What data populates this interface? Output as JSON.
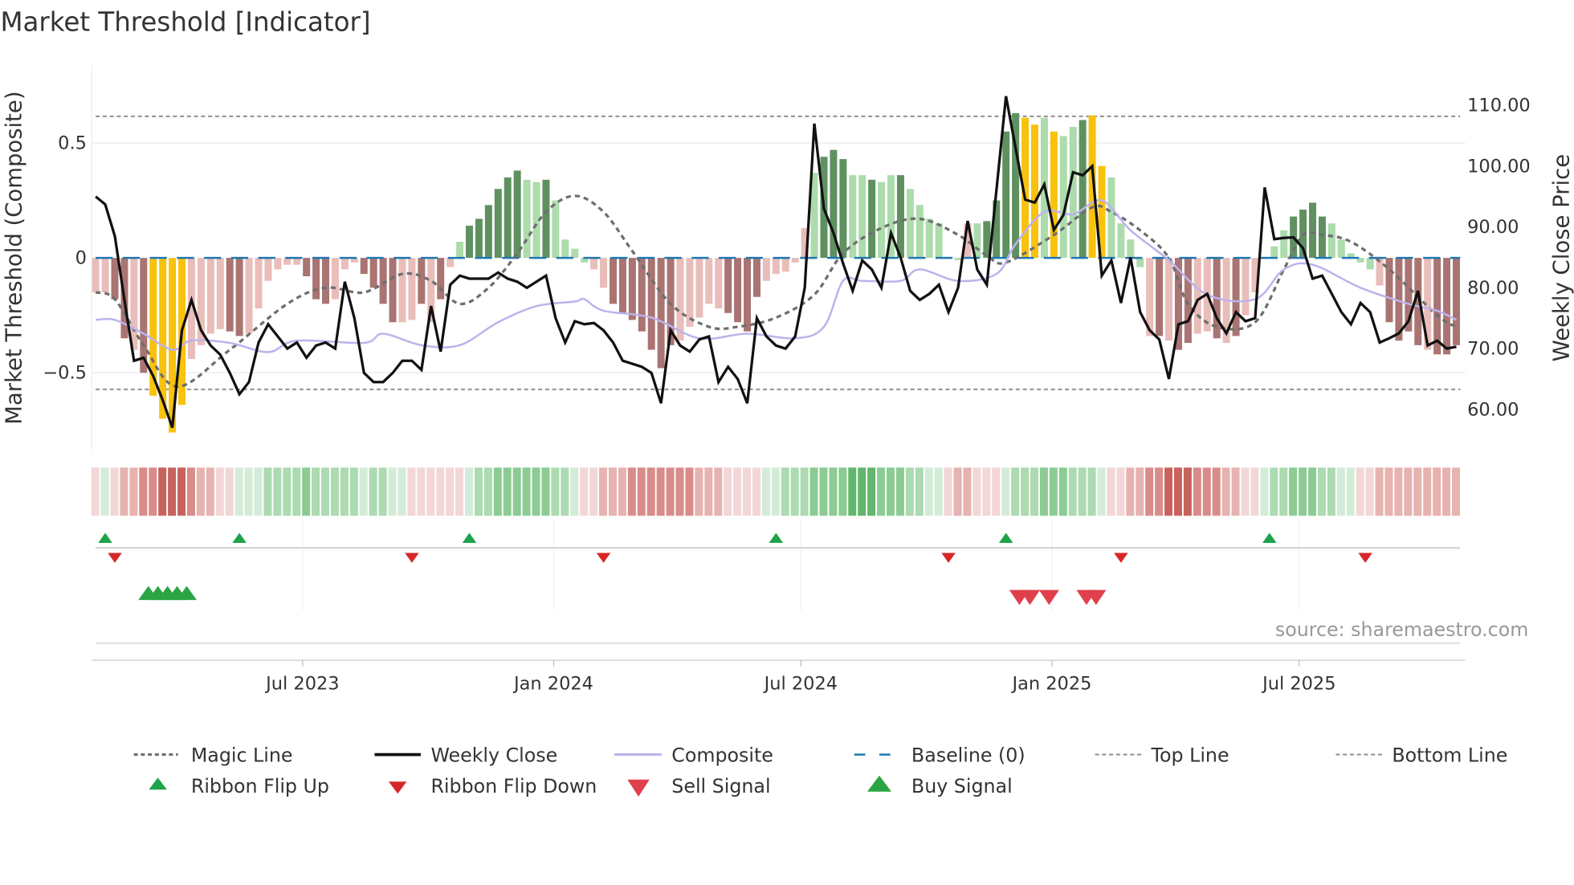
{
  "title": "Market Threshold [Indicator]",
  "source": "source: sharemaestro.com",
  "colors": {
    "bar_dark_red": "#a97472",
    "bar_light_red": "#e9bdb9",
    "bar_dark_green": "#5f9160",
    "bar_light_green": "#acdcab",
    "bar_gold": "#f8c20d",
    "weekly_close": "#111111",
    "composite": "#bcb3ec",
    "magic": "#6e6e6e",
    "baseline": "#1f77b4",
    "threshold": "#888888",
    "flip_up": "#1ea34a",
    "flip_down": "#d62728",
    "buy": "#2ca444",
    "sell": "#e0404c",
    "ribbon_green": [
      "#d3ecd7",
      "#acdab1",
      "#8ccb93",
      "#62b66d"
    ],
    "ribbon_red": [
      "#f3d6d6",
      "#e6b3b0",
      "#d98c89",
      "#c8625d"
    ]
  },
  "chart_data": {
    "type": "bar",
    "title": "Market Threshold [Indicator]",
    "xlabel": "",
    "ylabel": "Market Threshold (Composite)",
    "y2label": "Weekly Close Price",
    "x_unit": "week index",
    "ylim": [
      -0.84,
      0.84
    ],
    "y2lim": [
      53,
      118
    ],
    "y_ticks": [
      {
        "v": 0.5,
        "label": "0.5"
      },
      {
        "v": 0,
        "label": "0"
      },
      {
        "v": -0.5,
        "label": "−0.5"
      }
    ],
    "y2_ticks": [
      {
        "v": 110,
        "label": "110.00"
      },
      {
        "v": 100,
        "label": "100.00"
      },
      {
        "v": 90,
        "label": "90.00"
      },
      {
        "v": 80,
        "label": "80.00"
      },
      {
        "v": 70,
        "label": "70.00"
      },
      {
        "v": 60,
        "label": "60.00"
      }
    ],
    "x_ticks": [
      {
        "week": 21.6,
        "label": "Jul 2023"
      },
      {
        "week": 47.8,
        "label": "Jan 2024"
      },
      {
        "week": 73.6,
        "label": "Jul 2024"
      },
      {
        "week": 99.8,
        "label": "Jan 2025"
      },
      {
        "week": 125.6,
        "label": "Jul 2025"
      }
    ],
    "top_line": 0.616,
    "bottom_line": -0.572,
    "baseline": 0,
    "composite_bars": [
      -0.15,
      -0.15,
      -0.18,
      -0.35,
      -0.4,
      -0.5,
      -0.6,
      -0.7,
      -0.76,
      -0.64,
      -0.44,
      -0.38,
      -0.33,
      -0.31,
      -0.32,
      -0.34,
      -0.33,
      -0.22,
      -0.1,
      -0.05,
      -0.03,
      -0.03,
      -0.08,
      -0.18,
      -0.2,
      -0.18,
      -0.05,
      -0.02,
      -0.07,
      -0.13,
      -0.2,
      -0.28,
      -0.28,
      -0.27,
      -0.2,
      -0.28,
      -0.18,
      -0.04,
      0.07,
      0.14,
      0.17,
      0.23,
      0.3,
      0.35,
      0.38,
      0.34,
      0.33,
      0.34,
      0.25,
      0.08,
      0.04,
      -0.02,
      -0.05,
      -0.13,
      -0.2,
      -0.24,
      -0.27,
      -0.32,
      -0.4,
      -0.48,
      -0.38,
      -0.36,
      -0.3,
      -0.26,
      -0.2,
      -0.22,
      -0.24,
      -0.28,
      -0.32,
      -0.17,
      -0.1,
      -0.07,
      -0.06,
      -0.02,
      0.13,
      0.37,
      0.44,
      0.47,
      0.43,
      0.36,
      0.36,
      0.34,
      0.33,
      0.36,
      0.36,
      0.3,
      0.23,
      0.17,
      0.15,
      0.0,
      -0.01,
      0.15,
      0.15,
      0.16,
      0.25,
      0.55,
      0.63,
      0.61,
      0.58,
      0.61,
      0.55,
      0.53,
      0.57,
      0.6,
      0.62,
      0.4,
      0.35,
      0.15,
      0.08,
      -0.04,
      -0.34,
      -0.34,
      -0.36,
      -0.4,
      -0.37,
      -0.33,
      -0.32,
      -0.35,
      -0.37,
      -0.34,
      -0.25,
      -0.15,
      0.0,
      0.05,
      0.12,
      0.18,
      0.21,
      0.24,
      0.18,
      0.15,
      0.08,
      0.02,
      -0.02,
      -0.05,
      -0.12,
      -0.28,
      -0.36,
      -0.32,
      -0.38,
      -0.4,
      -0.42,
      -0.42,
      -0.38
    ],
    "bar_categories": "LLRRLRYYYYLLLLRRLLLLLLRRRLLLRRRRLLRLRLgGGGGGGggGggggLLRRRRRRRLLLLLRRRRLLLLLgGGGggGggGggggggLgGGGGYYgYggGYYggggLRLRRLLRLRLLLggGGGGgggggLRRRRLRRRLL",
    "weekly_close": [
      95,
      93.7,
      88.5,
      78,
      68,
      68.5,
      65.5,
      61.5,
      57,
      73,
      78,
      73,
      70.5,
      69,
      66,
      62.5,
      64.5,
      71,
      74,
      72,
      70,
      71,
      68.5,
      70.5,
      71,
      70,
      81,
      75,
      66,
      64.5,
      64.5,
      66,
      68,
      68,
      66.5,
      77,
      69.5,
      80.5,
      82,
      81.5,
      81.5,
      81.5,
      82.5,
      81.5,
      81,
      80,
      81,
      82,
      75,
      71,
      74.5,
      74,
      74.2,
      73,
      71,
      68,
      67.5,
      67,
      66,
      61,
      73,
      70.5,
      69.5,
      71.5,
      72,
      64.5,
      67,
      65,
      61,
      75,
      72,
      70.5,
      70,
      72,
      80,
      107,
      93,
      89,
      84,
      79.5,
      84.5,
      83,
      80,
      89,
      85,
      79.5,
      78,
      79,
      80.5,
      76,
      80,
      91,
      83,
      80.5,
      96,
      111.5,
      103,
      94.5,
      94,
      97,
      89.5,
      92,
      99,
      98.5,
      100,
      82,
      84.5,
      77.5,
      85,
      76,
      73,
      71.5,
      65,
      74,
      74.5,
      78,
      79,
      75,
      72.5,
      76,
      74.5,
      75,
      96.5,
      88,
      88.2,
      88.3,
      86.5,
      81.5,
      82,
      79,
      76,
      74,
      77.5,
      76,
      71,
      71.7,
      72.5,
      74.5,
      79.5,
      70.5,
      71.3,
      70,
      70.3
    ],
    "composite_line": [
      [
        0,
        -0.27
      ],
      [
        2,
        -0.27
      ],
      [
        5,
        -0.33
      ],
      [
        8,
        -0.4
      ],
      [
        10,
        -0.36
      ],
      [
        14,
        -0.37
      ],
      [
        18,
        -0.41
      ],
      [
        21,
        -0.36
      ],
      [
        28,
        -0.37
      ],
      [
        30,
        -0.33
      ],
      [
        34,
        -0.38
      ],
      [
        38,
        -0.38
      ],
      [
        42,
        -0.28
      ],
      [
        46,
        -0.21
      ],
      [
        50,
        -0.19
      ],
      [
        51,
        -0.18
      ],
      [
        53,
        -0.23
      ],
      [
        58,
        -0.26
      ],
      [
        63,
        -0.35
      ],
      [
        68,
        -0.33
      ],
      [
        73,
        -0.35
      ],
      [
        76,
        -0.3
      ],
      [
        78,
        -0.1
      ],
      [
        80,
        -0.1
      ],
      [
        84,
        -0.1
      ],
      [
        86,
        -0.05
      ],
      [
        90,
        -0.1
      ],
      [
        94,
        -0.07
      ],
      [
        96,
        0.06
      ],
      [
        99,
        0.2
      ],
      [
        102,
        0.19
      ],
      [
        105,
        0.25
      ],
      [
        108,
        0.12
      ],
      [
        112,
        -0.01
      ],
      [
        116,
        -0.16
      ],
      [
        121,
        -0.18
      ],
      [
        124,
        -0.05
      ],
      [
        127,
        -0.03
      ],
      [
        132,
        -0.13
      ],
      [
        137,
        -0.2
      ],
      [
        140,
        -0.23
      ],
      [
        142,
        -0.27
      ]
    ],
    "magic_line": [
      [
        0,
        -0.15
      ],
      [
        2,
        -0.18
      ],
      [
        5,
        -0.38
      ],
      [
        8.5,
        -0.56
      ],
      [
        14,
        -0.4
      ],
      [
        20,
        -0.2
      ],
      [
        24,
        -0.13
      ],
      [
        28,
        -0.15
      ],
      [
        32,
        -0.07
      ],
      [
        35,
        -0.1
      ],
      [
        38,
        -0.2
      ],
      [
        41,
        -0.13
      ],
      [
        44,
        0.02
      ],
      [
        47,
        0.2
      ],
      [
        50,
        0.27
      ],
      [
        53,
        0.2
      ],
      [
        56,
        0.03
      ],
      [
        60,
        -0.2
      ],
      [
        64,
        -0.3
      ],
      [
        67,
        -0.3
      ],
      [
        71,
        -0.26
      ],
      [
        75,
        -0.16
      ],
      [
        78,
        0.02
      ],
      [
        82,
        0.13
      ],
      [
        86,
        0.17
      ],
      [
        90,
        0.1
      ],
      [
        93,
        0.01
      ],
      [
        95,
        -0.02
      ],
      [
        100,
        0.1
      ],
      [
        104,
        0.22
      ],
      [
        106,
        0.2
      ],
      [
        109,
        0.12
      ],
      [
        112,
        0.0
      ],
      [
        114,
        -0.2
      ],
      [
        117,
        -0.3
      ],
      [
        121,
        -0.28
      ],
      [
        124,
        -0.05
      ],
      [
        126,
        0.1
      ],
      [
        128,
        0.1
      ],
      [
        131,
        0.07
      ],
      [
        135,
        -0.05
      ],
      [
        140,
        -0.25
      ],
      [
        142,
        -0.3
      ]
    ],
    "ribbon_levels": [
      -1,
      1,
      -1,
      -2,
      -2,
      -3,
      -3,
      -4,
      -4,
      -4,
      -3,
      -2,
      -2,
      -1,
      -1,
      1,
      1,
      1,
      2,
      2,
      2,
      2,
      3,
      2,
      2,
      2,
      2,
      2,
      1,
      2,
      2,
      1,
      1,
      -1,
      -1,
      -1,
      -1,
      -1,
      -1,
      1,
      2,
      2,
      3,
      3,
      3,
      3,
      3,
      3,
      2,
      2,
      1,
      -1,
      -1,
      -2,
      -2,
      -2,
      -3,
      -3,
      -3,
      -3,
      -3,
      -3,
      -3,
      -2,
      -2,
      -2,
      -1,
      -1,
      -1,
      -1,
      1,
      1,
      2,
      2,
      2,
      3,
      3,
      3,
      3,
      4,
      4,
      4,
      3,
      3,
      3,
      2,
      2,
      1,
      1,
      -1,
      -2,
      -2,
      -1,
      -1,
      -1,
      1,
      2,
      2,
      2,
      3,
      3,
      3,
      2,
      2,
      2,
      1,
      -1,
      -1,
      -2,
      -2,
      -3,
      -3,
      -4,
      -4,
      -4,
      -3,
      -3,
      -3,
      -2,
      -2,
      -1,
      -1,
      1,
      2,
      2,
      3,
      3,
      3,
      2,
      2,
      1,
      1,
      -1,
      -1,
      -2,
      -2,
      -2,
      -2,
      -2,
      -2,
      -2,
      -2,
      -2
    ],
    "ribbon_flip_up": [
      1,
      15,
      39,
      71,
      95,
      122.5
    ],
    "ribbon_flip_down": [
      2,
      33,
      53,
      89,
      107,
      132.5
    ],
    "buy_signals": [
      5.5,
      6.5,
      7.5,
      8.5,
      9.5
    ],
    "sell_signals": [
      96.4,
      97.5,
      99.5,
      103.4,
      104.4
    ],
    "legend_placement": "bottom"
  },
  "legend": {
    "magic_line": "Magic Line",
    "weekly_close": "Weekly Close",
    "composite": "Composite",
    "baseline": "Baseline (0)",
    "top_line": "Top Line",
    "bottom_line": "Bottom Line",
    "ribbon_flip_up": "Ribbon Flip Up",
    "ribbon_flip_down": "Ribbon Flip Down",
    "sell_signal": "Sell Signal",
    "buy_signal": "Buy Signal"
  }
}
